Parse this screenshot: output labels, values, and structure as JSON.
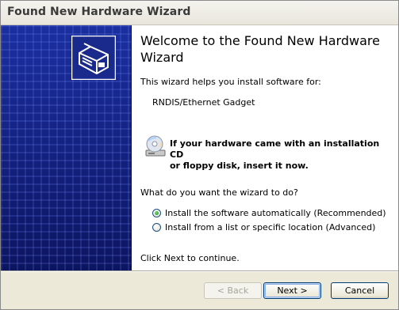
{
  "window": {
    "title": "Found New Hardware Wizard"
  },
  "icons": {
    "hardware": "hardware-box-icon",
    "cd": "cd-drive-icon"
  },
  "main": {
    "heading": "Welcome to the Found New Hardware Wizard",
    "intro": "This wizard helps you install software for:",
    "device": "RNDIS/Ethernet Gadget",
    "cd_prompt_line1": "If your hardware came with an installation CD",
    "cd_prompt_line2": "or floppy disk, insert it now.",
    "question": "What do you want the wizard to do?",
    "options": [
      {
        "label": "Install the software automatically (Recommended)",
        "checked": true
      },
      {
        "label": "Install from a list or specific location (Advanced)",
        "checked": false
      }
    ],
    "next_hint": "Click Next to continue."
  },
  "buttons": {
    "back": "< Back",
    "next": "Next >",
    "cancel": "Cancel"
  },
  "colors": {
    "side_panel": "#172788",
    "button_border": "#003c74",
    "window_bg": "#ece9d8"
  }
}
